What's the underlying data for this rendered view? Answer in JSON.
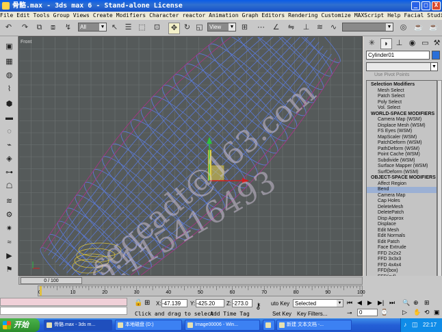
{
  "window": {
    "title": "骨骼.max - 3ds max 6 - Stand-alone License",
    "min": "_",
    "max": "□",
    "close": "X"
  },
  "menu": [
    "File",
    "Edit",
    "Tools",
    "Group",
    "Views",
    "Create",
    "Modifiers",
    "Character",
    "reactor",
    "Animation",
    "Graph Editors",
    "Rendering",
    "Customize",
    "MAXScript",
    "Help",
    "Facial Studio"
  ],
  "toolbar": {
    "selection_filter": "All",
    "coord_system": "View"
  },
  "viewport": {
    "label": "Front"
  },
  "watermarks": [
    "sqqeadt@163.com",
    "QQ:115416493"
  ],
  "panel": {
    "object_name": "Cylinder01",
    "use_pivot": "Use Pivot Points",
    "sections": [
      {
        "header": "Selection Modifiers",
        "items": [
          "Mesh Select",
          "Patch Select",
          "Poly Select",
          "Vol. Select"
        ]
      },
      {
        "header": "WORLD-SPACE MODIFIERS",
        "items": [
          "Camera Map (WSM)",
          "Displace Mesh (WSM)",
          "FS Eyes (WSM)",
          "MapScaler (WSM)",
          "PatchDeform (WSM)",
          "PathDeform (WSM)",
          "Point Cache (WSM)",
          "Subdivide (WSM)",
          "Surface Mapper (WSM)",
          "SurfDeform (WSM)"
        ]
      },
      {
        "header": "OBJECT-SPACE MODIFIERS",
        "items": [
          "Affect Region",
          "Bend",
          "Camera Map",
          "Cap Holes",
          "DeleteMesh",
          "DeletePatch",
          "Disp Approx",
          "Displace",
          "Edit Mesh",
          "Edit Normals",
          "Edit Patch",
          "Face Extrude",
          "FFD 2x2x2",
          "FFD 3x3x3",
          "FFD 4x4x4",
          "FFD(box)",
          "FFD(cyl)",
          "Flex",
          "HSDS",
          "Lattice",
          "Linked XForm"
        ]
      }
    ],
    "selected_item": "Bend"
  },
  "timeline": {
    "frame": "0 / 100",
    "ticks": [
      "0",
      "10",
      "20",
      "30",
      "40",
      "50",
      "60",
      "70",
      "80",
      "90",
      "100"
    ]
  },
  "status": {
    "x_label": "X:",
    "x": "-47.139",
    "y_label": "Y:",
    "y": "-425.20",
    "z_label": "Z:",
    "z": "-273.0",
    "prompt": "Click and drag to select",
    "add_time_tag": "Add Time Tag",
    "auto_key": "uto Key",
    "key_mode": "Selected",
    "set_key": "Set Key",
    "key_filters": "Key Filters...",
    "frame_value": "0"
  },
  "taskbar": {
    "start": "开始",
    "tasks": [
      "骨骼.max - 3ds m...",
      "本地磁盘 (D:)",
      "Image00006 - Win...",
      "",
      "新建 文本文档 -..."
    ],
    "clock": "22:17"
  },
  "colors": {
    "title": "#0a5ce8",
    "viewport": "#555a5a",
    "highlight": "#9bb0d4",
    "wire_blue": "#5b7ad8",
    "wire_magenta": "#b0308a"
  }
}
